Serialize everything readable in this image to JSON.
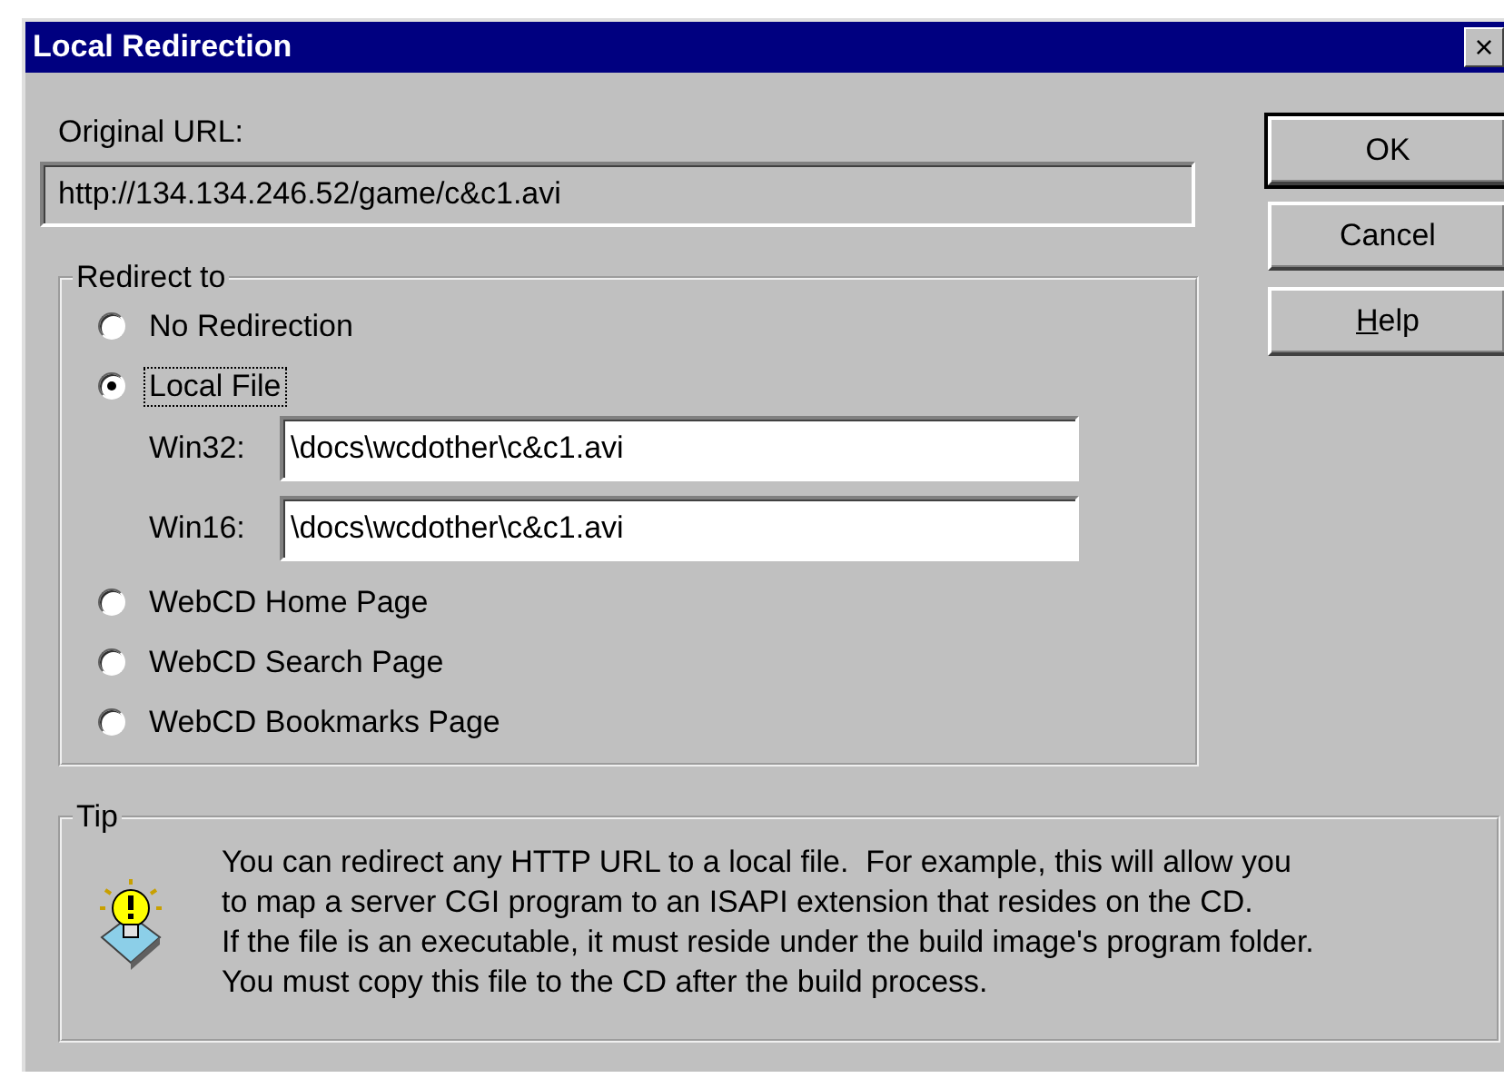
{
  "window": {
    "title": "Local Redirection",
    "close": "×"
  },
  "original_url": {
    "label": "Original URL:",
    "value": "http://134.134.246.52/game/c&c1.avi"
  },
  "redirect_group": {
    "legend": "Redirect to",
    "options": [
      {
        "label": "No Redirection",
        "selected": false,
        "focused": false
      },
      {
        "label": "Local File",
        "selected": true,
        "focused": true,
        "fields": [
          {
            "label": "Win32:",
            "value": "\\docs\\wcdother\\c&c1.avi"
          },
          {
            "label": "Win16:",
            "value": "\\docs\\wcdother\\c&c1.avi"
          }
        ]
      },
      {
        "label": "WebCD Home Page",
        "selected": false,
        "focused": false
      },
      {
        "label": "WebCD Search Page",
        "selected": false,
        "focused": false
      },
      {
        "label": "WebCD Bookmarks Page",
        "selected": false,
        "focused": false
      }
    ]
  },
  "tip": {
    "legend": "Tip",
    "lines": [
      "You can redirect any HTTP URL to a local file.  For example, this will allow you",
      "to map a server CGI program to an ISAPI extension that resides on the CD.",
      "If the file is an executable, it must reside under the build image's program folder.",
      "You must copy this file to the CD after the build process."
    ]
  },
  "buttons": [
    {
      "label": "OK",
      "default": true
    },
    {
      "label": "Cancel",
      "default": false
    },
    {
      "mnemonic": "H",
      "rest": "elp",
      "default": false
    }
  ]
}
